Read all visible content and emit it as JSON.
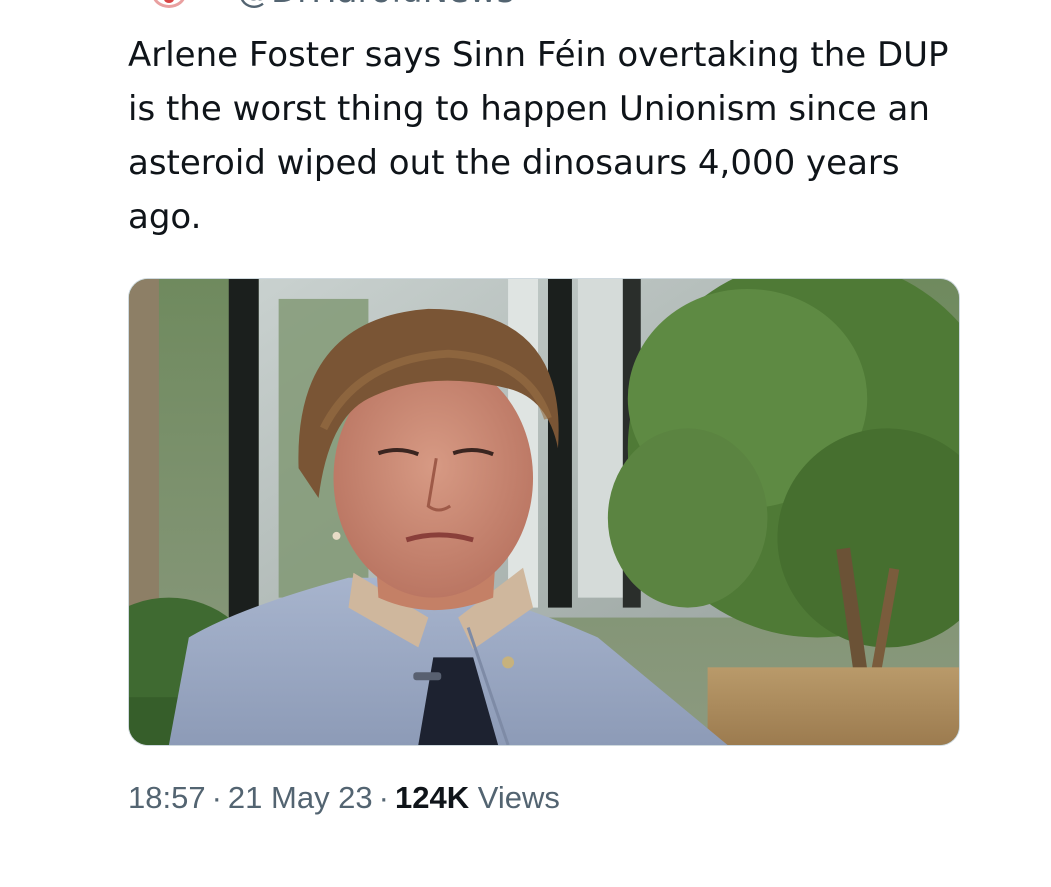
{
  "tweet": {
    "handle": "@DrHaroldNews",
    "text": "Arlene Foster says Sinn Féin overtaking the DUP is the worst thing to happen Unionism since an asteroid wiped out the dinosaurs 4,000 years ago.",
    "media": {
      "description": "photo-of-woman-in-light-blue-jacket-outdoors"
    },
    "meta": {
      "time": "18:57",
      "separator": "·",
      "date": "21 May 23",
      "views_count": "124K",
      "views_label": "Views"
    }
  },
  "colors": {
    "text_primary": "#0f1419",
    "text_secondary": "#536471",
    "avatar_accent": "#d94545"
  }
}
